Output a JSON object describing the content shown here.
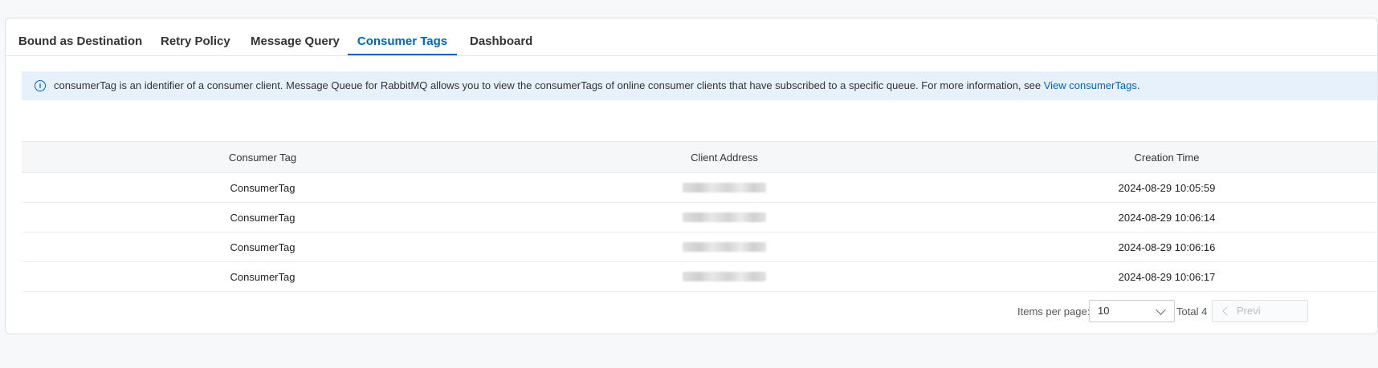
{
  "tabs": [
    {
      "label": "Bound as Destination",
      "active": false
    },
    {
      "label": "Retry Policy",
      "active": false
    },
    {
      "label": "Message Query",
      "active": false
    },
    {
      "label": "Consumer Tags",
      "active": true
    },
    {
      "label": "Dashboard",
      "active": false
    }
  ],
  "notice": {
    "text": "consumerTag is an identifier of a consumer client. Message Queue for RabbitMQ allows you to view the consumerTags of online consumer clients that have subscribed to a specific queue. For more information, see ",
    "link": "View consumerTags",
    "suffix": ".",
    "icon": "info-icon"
  },
  "table": {
    "columns": [
      "Consumer Tag",
      "Client Address",
      "Creation Time"
    ],
    "rows": [
      {
        "tag": "ConsumerTag",
        "address": "",
        "time": "2024-08-29 10:05:59"
      },
      {
        "tag": "ConsumerTag",
        "address": "",
        "time": "2024-08-29 10:06:14"
      },
      {
        "tag": "ConsumerTag",
        "address": "",
        "time": "2024-08-29 10:06:16"
      },
      {
        "tag": "ConsumerTag",
        "address": "",
        "time": "2024-08-29 10:06:17"
      }
    ]
  },
  "pagination": {
    "items_label": "Items per page:",
    "page_size": "10",
    "total": "Total 4",
    "prev_label": "Previ"
  },
  "colors": {
    "accent": "#0064c8",
    "notice_bg": "#e6f1fc"
  }
}
